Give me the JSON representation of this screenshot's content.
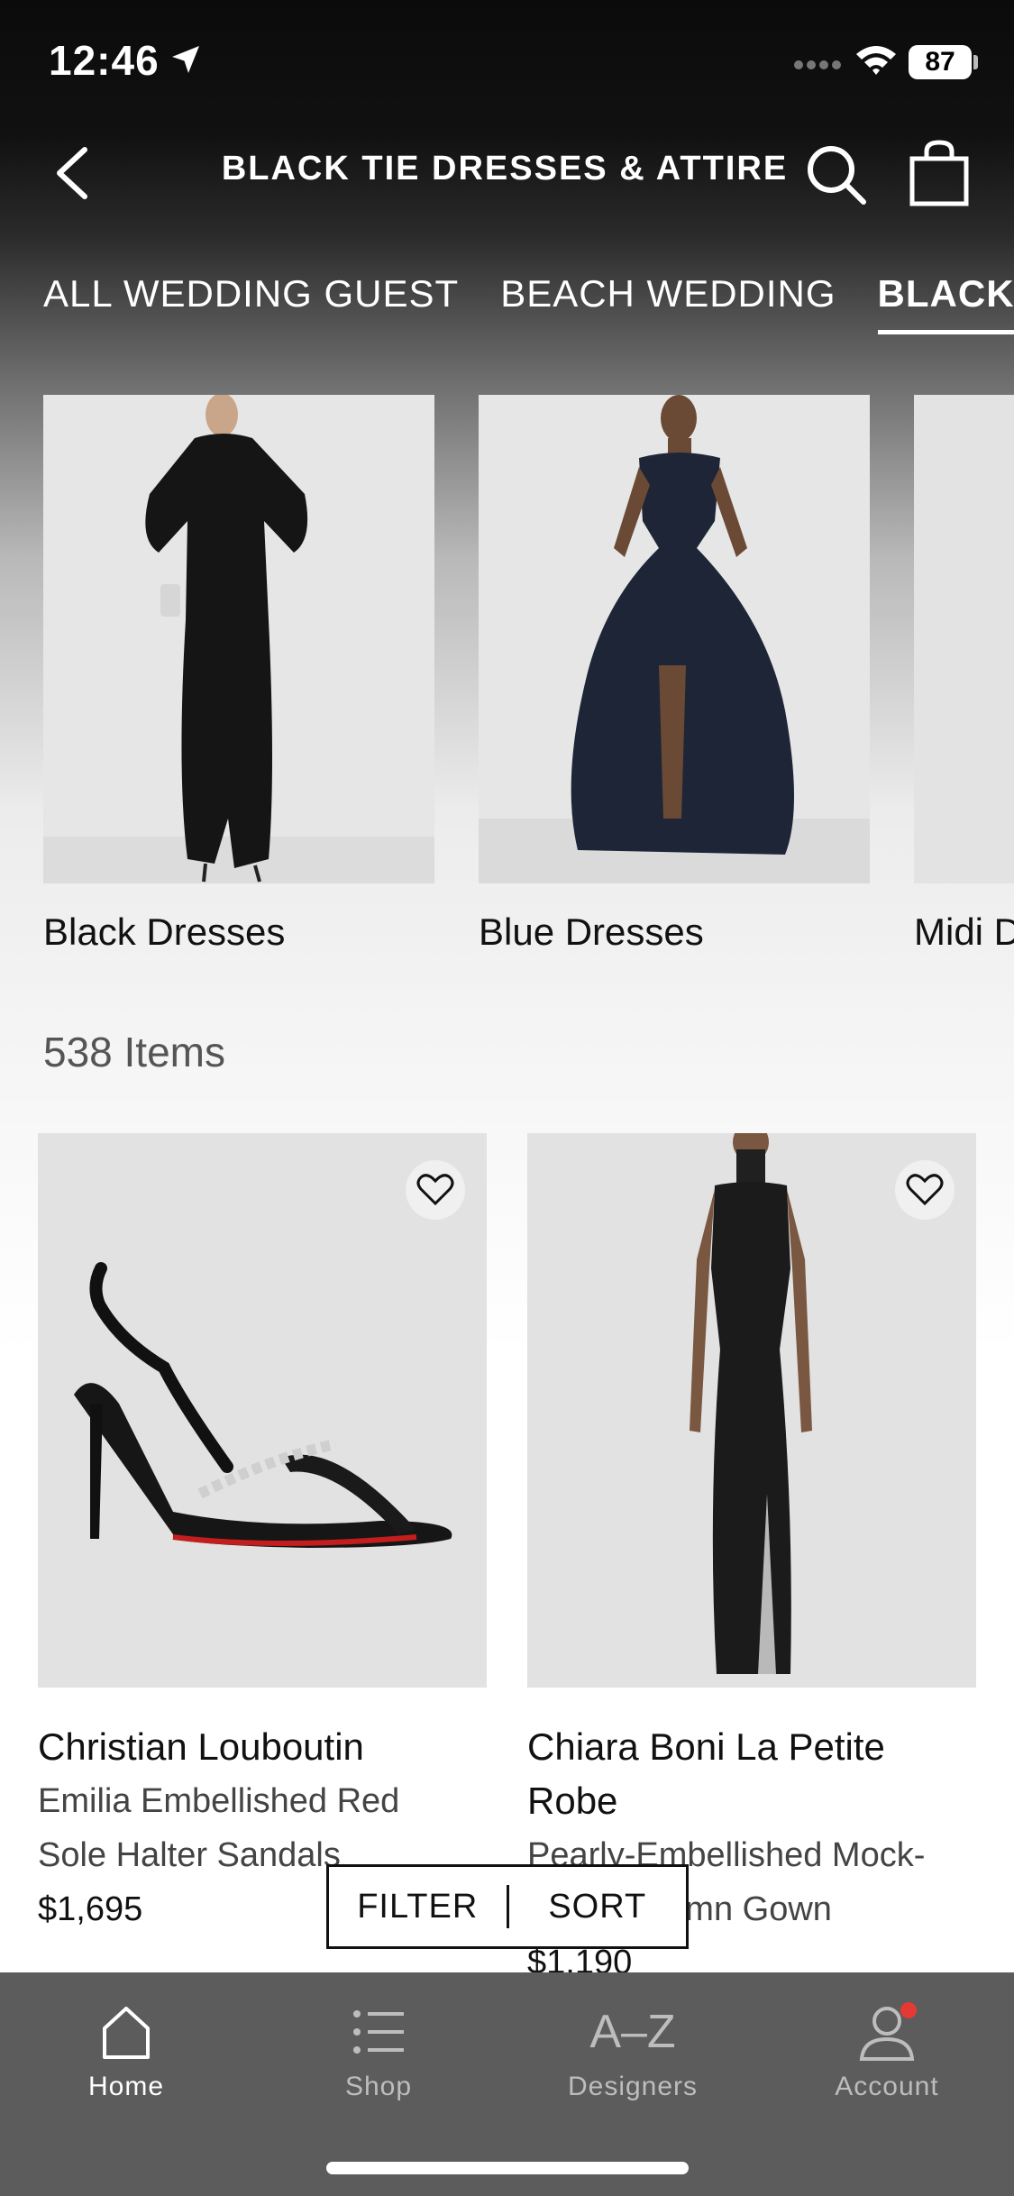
{
  "status_bar": {
    "time": "12:46",
    "battery": "87"
  },
  "header": {
    "title": "BLACK TIE DRESSES & ATTIRE"
  },
  "tabs": [
    {
      "label": "ALL WEDDING GUEST"
    },
    {
      "label": "BEACH WEDDING"
    },
    {
      "label": "BLACK-TIE"
    }
  ],
  "subcategories": [
    {
      "label": "Black Dresses"
    },
    {
      "label": "Blue Dresses"
    },
    {
      "label": "Midi Dresses"
    }
  ],
  "items_count": "538 Items",
  "products": [
    {
      "brand": "Christian Louboutin",
      "name_line1": "Emilia Embellished Red",
      "name_line2": "Sole Halter Sandals",
      "price": "$1,695"
    },
    {
      "brand_line1": "Chiara Boni La Petite",
      "brand_line2": "Robe",
      "name_line1": "Pearly-Embellished Mock-",
      "name_line2": "Neck Column Gown",
      "price": "$1,190"
    }
  ],
  "filter_sort": {
    "filter": "FILTER",
    "sort": "SORT"
  },
  "bottom_nav": [
    {
      "label": "Home",
      "icon": "home-icon",
      "active": true
    },
    {
      "label": "Shop",
      "icon": "list-icon"
    },
    {
      "label": "Designers",
      "icon": "a-z-icon",
      "glyph": "A–Z"
    },
    {
      "label": "Account",
      "icon": "user-icon",
      "badge_color": "#e53935"
    }
  ]
}
